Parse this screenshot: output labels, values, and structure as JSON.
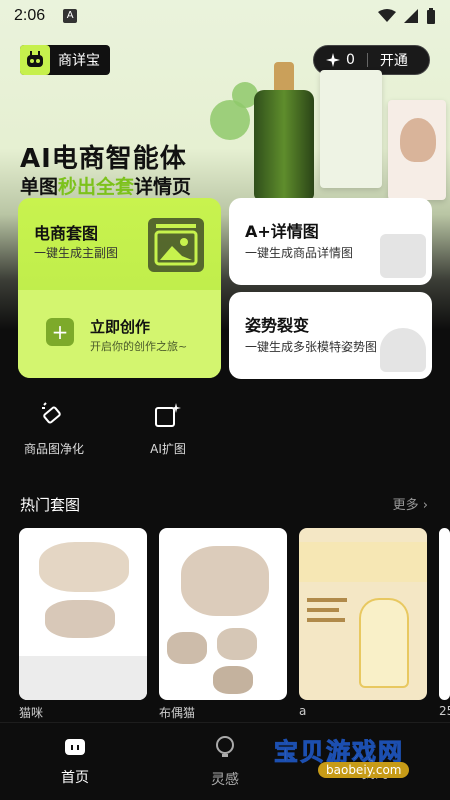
{
  "status_bar": {
    "time": "2:06"
  },
  "brand": {
    "name": "商详宝"
  },
  "credits": {
    "count": "0",
    "upgrade_label": "开通"
  },
  "hero": {
    "title": "AI电商智能体",
    "subtitle_part1": "单图",
    "subtitle_highlight": "秒出全套",
    "subtitle_part2": "详情页"
  },
  "cards": {
    "suite": {
      "title": "电商套图",
      "desc": "一键生成主副图"
    },
    "create": {
      "title": "立即创作",
      "desc": "开启你的创作之旅~"
    },
    "detail": {
      "title": "A+详情图",
      "desc": "一键生成商品详情图"
    },
    "pose": {
      "title": "姿势裂变",
      "desc": "一键生成多张模特姿势图"
    }
  },
  "tools": [
    {
      "label": "商品图净化",
      "icon": "eraser-icon"
    },
    {
      "label": "AI扩图",
      "icon": "expand-image-icon"
    }
  ],
  "hot_section": {
    "title": "热门套图",
    "more": "更多"
  },
  "thumbnails": [
    {
      "label": "猫咪"
    },
    {
      "label": "布偶猫"
    },
    {
      "label": "a"
    },
    {
      "label": "25"
    }
  ],
  "nav": {
    "home": "首页",
    "inspiration": "灵感",
    "profile": "我的"
  },
  "watermark": {
    "text": "宝贝游戏网",
    "url": "baobeiy.com"
  },
  "colors": {
    "accent": "#c8f34e",
    "highlight": "#7cc21b",
    "background": "#0d0d0d"
  }
}
